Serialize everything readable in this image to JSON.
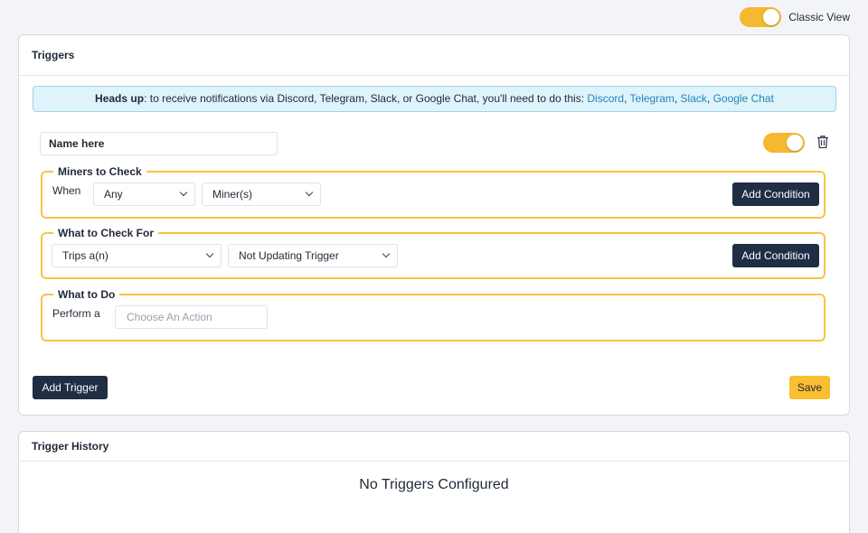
{
  "header": {
    "classic_view_label": "Classic View",
    "classic_view_on": true
  },
  "triggers_card": {
    "title": "Triggers",
    "alert": {
      "lead": "Heads up",
      "text": ": to receive notifications via Discord, Telegram, Slack, or Google Chat, you'll need to do this: ",
      "links": [
        "Discord",
        "Telegram",
        "Slack",
        "Google Chat"
      ],
      "separator": ", "
    },
    "trigger": {
      "name_value": "Name here",
      "enabled": true,
      "miners_group": {
        "legend": "Miners to Check",
        "when_label": "When",
        "any_select": "Any",
        "miners_select": "Miner(s)",
        "add_condition": "Add Condition"
      },
      "check_group": {
        "legend": "What to Check For",
        "trips_select": "Trips a(n)",
        "trigger_select": "Not Updating Trigger",
        "add_condition": "Add Condition"
      },
      "action_group": {
        "legend": "What to Do",
        "perform_label": "Perform a",
        "action_placeholder": "Choose An Action"
      }
    },
    "add_trigger": "Add Trigger",
    "save": "Save"
  },
  "history_card": {
    "title": "Trigger History",
    "empty_message": "No Triggers Configured"
  },
  "colors": {
    "accent_yellow": "#f9be32",
    "group_border": "#f5c542",
    "dark_button": "#1f2d45",
    "link": "#1e88b8",
    "alert_bg": "#dff3fb"
  }
}
